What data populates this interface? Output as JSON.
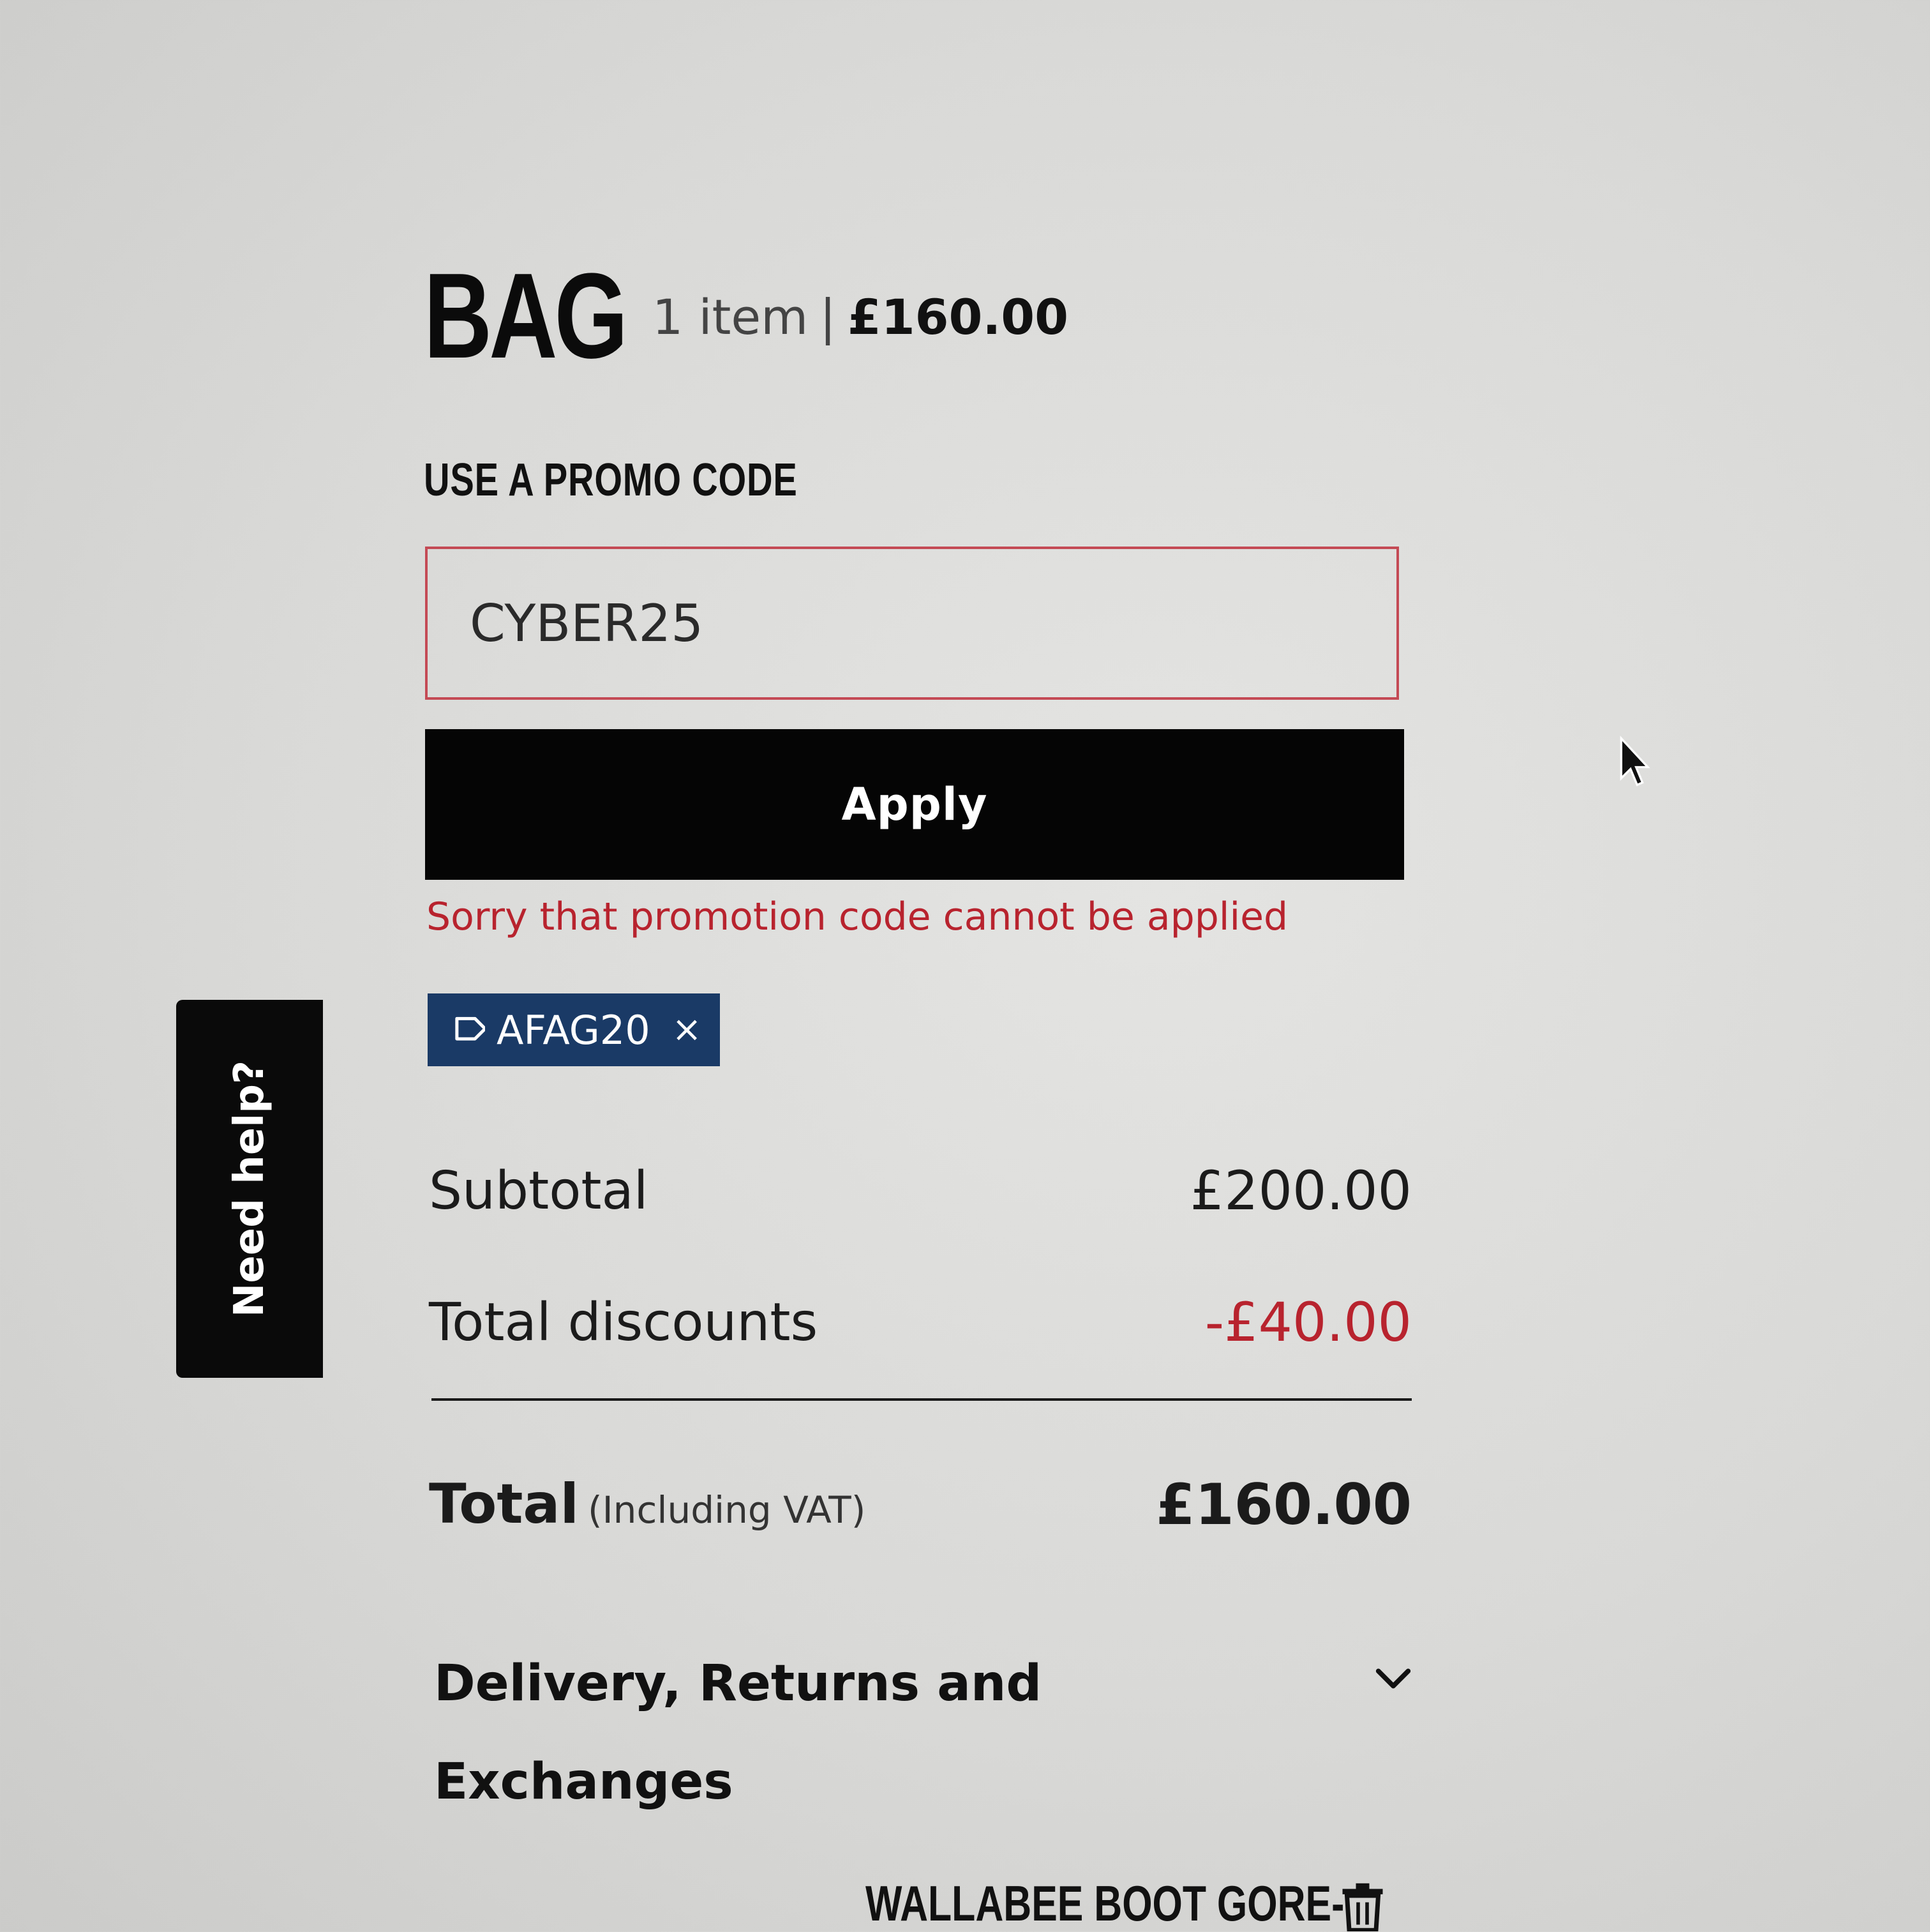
{
  "bag": {
    "title": "BAG",
    "item_count": "1 item",
    "separator": "|",
    "total_amount": "£160.00"
  },
  "promo": {
    "label": "USE A PROMO CODE",
    "input_value": "CYBER25",
    "apply_label": "Apply",
    "error_message": "Sorry that promotion code cannot be applied",
    "applied_code": "AFAG20",
    "remove_symbol": "×"
  },
  "summary": {
    "subtotal_label": "Subtotal",
    "subtotal_value": "£200.00",
    "discounts_label": "Total discounts",
    "discounts_value": "-£40.00",
    "total_label": "Total",
    "total_note": "(Including VAT)",
    "total_value": "£160.00"
  },
  "delivery": {
    "title": "Delivery, Returns and Exchanges"
  },
  "product": {
    "name": "WALLABEE BOOT GORE-"
  },
  "help": {
    "label": "Need help?"
  },
  "colors": {
    "error": "#b8232e",
    "chip_bg": "#1a3a66",
    "button_bg": "#050505"
  },
  "icons": {
    "tag": "tag-icon",
    "remove": "close-icon",
    "chevron": "chevron-down-icon",
    "trash": "trash-icon",
    "cursor": "mouse-pointer-icon"
  }
}
